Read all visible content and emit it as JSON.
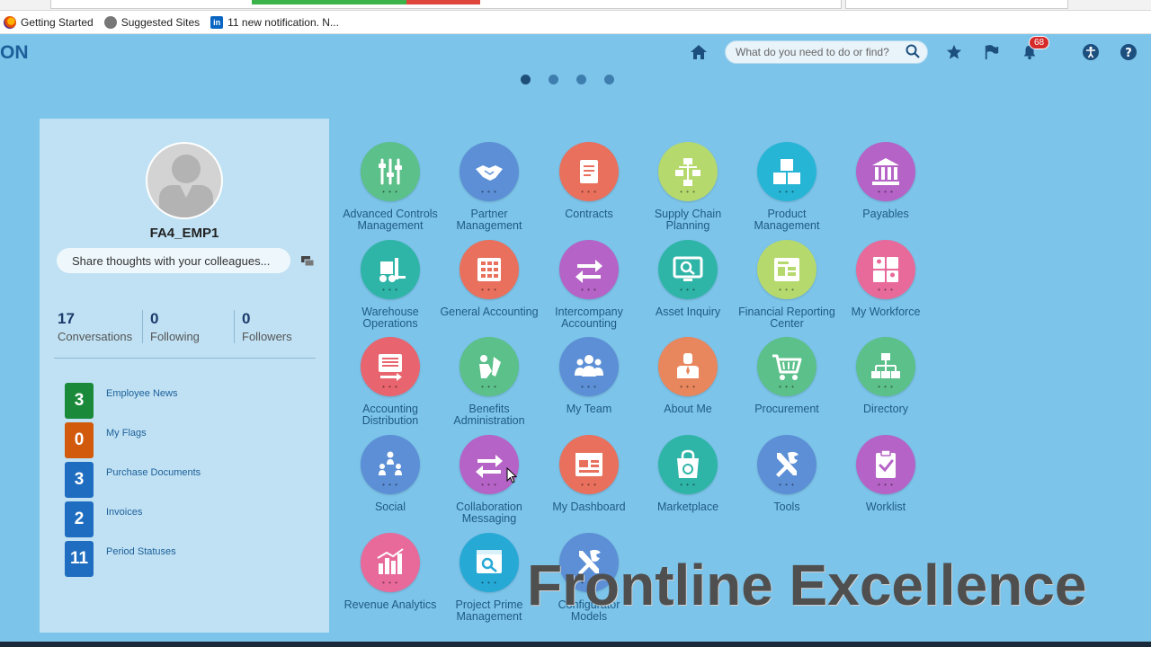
{
  "browser": {
    "bookmarks": [
      {
        "label": "Getting Started",
        "icon": "firefox-icon"
      },
      {
        "label": "Suggested Sites",
        "icon": "ie-icon"
      },
      {
        "label": "11 new notification.  N...",
        "icon": "linkedin-icon"
      }
    ]
  },
  "header": {
    "logo_text": "ON",
    "search_placeholder": "What do you need to do or find?",
    "notification_count": "68"
  },
  "carousel": {
    "pages": 4,
    "active": 1
  },
  "profile": {
    "username": "FA4_EMP1",
    "share_placeholder": "Share thoughts with your colleagues...",
    "stats": [
      {
        "num": "17",
        "label": "Conversations"
      },
      {
        "num": "0",
        "label": "Following"
      },
      {
        "num": "0",
        "label": "Followers"
      }
    ],
    "counters": [
      {
        "num": "3",
        "label": "Employee News",
        "color": "#1a8a3a"
      },
      {
        "num": "0",
        "label": "My Flags",
        "color": "#d25a0c"
      },
      {
        "num": "3",
        "label": "Purchase Documents",
        "color": "#1f6dc0"
      },
      {
        "num": "2",
        "label": "Invoices",
        "color": "#1f6dc0"
      },
      {
        "num": "11",
        "label": "Period Statuses",
        "color": "#1f6dc0"
      }
    ]
  },
  "apps": [
    {
      "label": "Advanced Controls Management",
      "color": "#5cc08a",
      "icon": "sliders-icon"
    },
    {
      "label": "Partner Management",
      "color": "#5c8fd6",
      "icon": "handshake-icon"
    },
    {
      "label": "Contracts",
      "color": "#e8705d",
      "icon": "scroll-icon"
    },
    {
      "label": "Supply Chain Planning",
      "color": "#b6d96e",
      "icon": "flowchart-icon"
    },
    {
      "label": "Product Management",
      "color": "#27b5d6",
      "icon": "boxes-icon"
    },
    {
      "label": "Payables",
      "color": "#b563c6",
      "icon": "bank-icon"
    },
    {
      "label": "Warehouse Operations",
      "color": "#2fb5a8",
      "icon": "forklift-icon"
    },
    {
      "label": "General Accounting",
      "color": "#e8705d",
      "icon": "ledger-icon"
    },
    {
      "label": "Intercompany Accounting",
      "color": "#b563c6",
      "icon": "exchange-icon"
    },
    {
      "label": "Asset Inquiry",
      "color": "#2fb5a8",
      "icon": "monitor-search-icon"
    },
    {
      "label": "Financial Reporting Center",
      "color": "#b6d96e",
      "icon": "report-icon"
    },
    {
      "label": "My Workforce",
      "color": "#e86a9a",
      "icon": "people-grid-icon"
    },
    {
      "label": "Accounting Distribution",
      "color": "#e8646e",
      "icon": "distribution-icon"
    },
    {
      "label": "Benefits Administration",
      "color": "#5cc08a",
      "icon": "benefits-icon"
    },
    {
      "label": "My Team",
      "color": "#5c8fd6",
      "icon": "team-icon"
    },
    {
      "label": "About Me",
      "color": "#e8865d",
      "icon": "person-icon"
    },
    {
      "label": "Procurement",
      "color": "#5cc08a",
      "icon": "cart-icon"
    },
    {
      "label": "Directory",
      "color": "#5cc08a",
      "icon": "org-chart-icon"
    },
    {
      "label": "Social",
      "color": "#5c8fd6",
      "icon": "social-icon"
    },
    {
      "label": "Collaboration Messaging",
      "color": "#b563c6",
      "icon": "exchange-icon"
    },
    {
      "label": "My Dashboard",
      "color": "#e8705d",
      "icon": "dashboard-icon"
    },
    {
      "label": "Marketplace",
      "color": "#2fb5a8",
      "icon": "shopping-bag-icon"
    },
    {
      "label": "Tools",
      "color": "#5c8fd6",
      "icon": "tools-icon"
    },
    {
      "label": "Worklist",
      "color": "#b563c6",
      "icon": "clipboard-check-icon"
    },
    {
      "label": "Revenue Analytics",
      "color": "#e86a9a",
      "icon": "bar-chart-icon"
    },
    {
      "label": "Project Prime Management",
      "color": "#27a9d6",
      "icon": "project-icon"
    },
    {
      "label": "Configurator Models",
      "color": "#5c8fd6",
      "icon": "tools-icon"
    }
  ],
  "watermark": "Frontline Excellence"
}
